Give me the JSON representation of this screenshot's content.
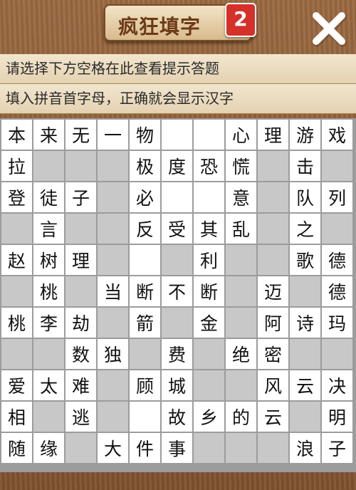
{
  "header": {
    "title": "疯狂填字",
    "badge": "2",
    "close_icon": "close-x-icon"
  },
  "hints": {
    "line1": "请选择下方空格在此查看提示答题",
    "line2": "填入拼音首字母，正确就会显示汉字"
  },
  "colors": {
    "wood": "#8a5a34",
    "plaque": "#f3e4c6",
    "badge": "#d5302a",
    "cell_white": "#ffffff",
    "cell_gray": "#c8c8c8"
  },
  "board": {
    "rows": [
      [
        "本",
        "来",
        "无",
        "一",
        "物",
        null,
        null,
        "心",
        "理",
        "游",
        "戏"
      ],
      [
        "拉",
        "",
        "",
        "",
        "极",
        "度",
        "恐",
        "慌",
        "",
        "击",
        ""
      ],
      [
        "登",
        "徒",
        "子",
        "",
        "必",
        null,
        null,
        "意",
        "",
        "队",
        "列"
      ],
      [
        "",
        "言",
        "",
        "",
        "反",
        "受",
        "其",
        "乱",
        "",
        "之",
        ""
      ],
      [
        "赵",
        "树",
        "理",
        "",
        null,
        "",
        "利",
        "",
        "",
        "歌",
        "德"
      ],
      [
        "",
        "桃",
        "",
        "当",
        "断",
        "不",
        "断",
        "",
        "迈",
        "",
        "德"
      ],
      [
        "桃",
        "李",
        "劫",
        "",
        "箭",
        "",
        "金",
        "",
        "阿",
        "诗",
        "玛"
      ],
      [
        "",
        "",
        "数",
        "独",
        "",
        "费",
        "",
        "绝",
        "密",
        "",
        ""
      ],
      [
        "爱",
        "太",
        "难",
        "",
        "顾",
        "城",
        "",
        "",
        "风",
        "云",
        "决"
      ],
      [
        "相",
        "",
        "逃",
        "",
        null,
        "故",
        "乡",
        "的",
        "云",
        "",
        "明"
      ],
      [
        "随",
        "缘",
        "",
        "大",
        "件",
        "事",
        "",
        "",
        "",
        "浪",
        "子"
      ]
    ]
  }
}
